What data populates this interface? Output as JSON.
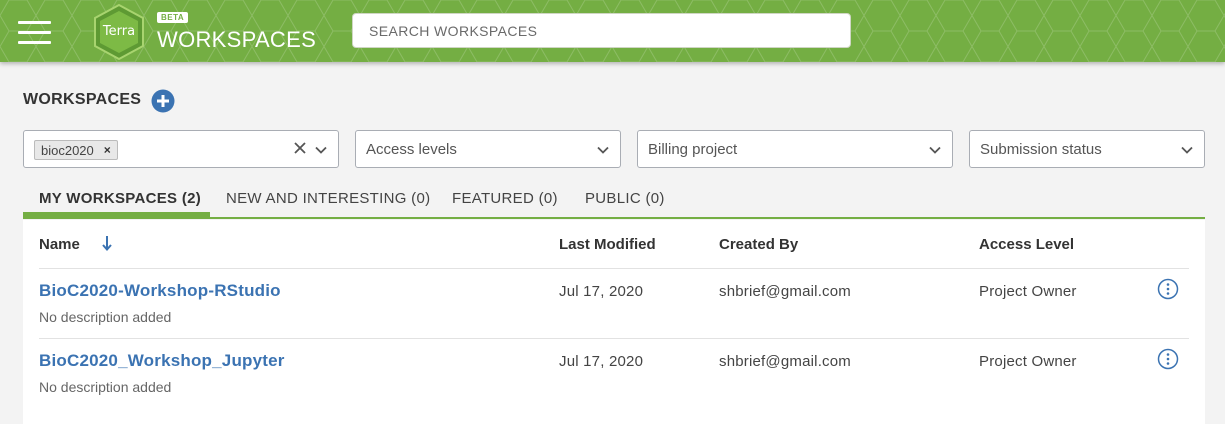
{
  "header": {
    "logo_text": "Terra",
    "beta_badge": "BETA",
    "title": "WORKSPACES",
    "search_placeholder": "SEARCH WORKSPACES",
    "colors": {
      "brand_green": "#74ae43",
      "link_blue": "#3b73b2"
    }
  },
  "page": {
    "heading": "WORKSPACES",
    "add_icon": "plus-circle-icon"
  },
  "filters": {
    "tag_chip": "bioc2020",
    "access_levels": "Access levels",
    "billing_project": "Billing project",
    "submission_status": "Submission status"
  },
  "tabs": [
    {
      "label": "MY WORKSPACES (2)",
      "active": true
    },
    {
      "label": "NEW AND INTERESTING (0)",
      "active": false
    },
    {
      "label": "FEATURED (0)",
      "active": false
    },
    {
      "label": "PUBLIC (0)",
      "active": false
    }
  ],
  "table": {
    "columns": [
      "Name",
      "Last Modified",
      "Created By",
      "Access Level"
    ],
    "rows": [
      {
        "name": "BioC2020-Workshop-RStudio",
        "description": "No description added",
        "last_modified": "Jul 17, 2020",
        "created_by": "shbrief@gmail.com",
        "access_level": "Project Owner"
      },
      {
        "name": "BioC2020_Workshop_Jupyter",
        "description": "No description added",
        "last_modified": "Jul 17, 2020",
        "created_by": "shbrief@gmail.com",
        "access_level": "Project Owner"
      }
    ]
  }
}
